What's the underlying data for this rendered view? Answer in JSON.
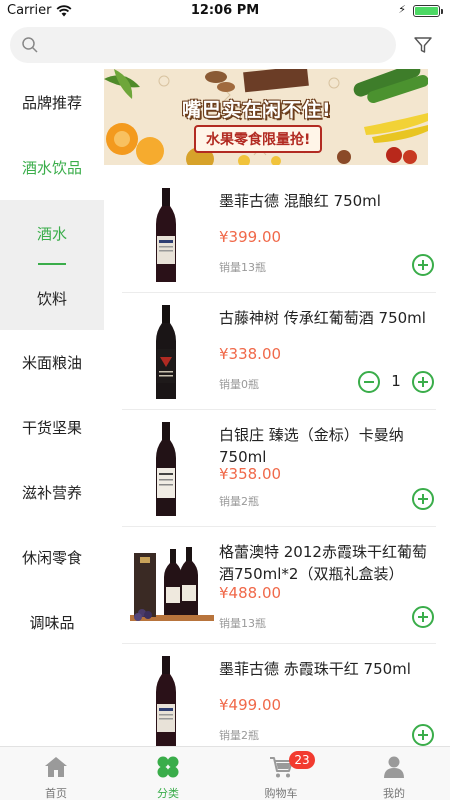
{
  "status_bar": {
    "carrier": "Carrier",
    "time": "12:06 PM"
  },
  "search": {
    "value": "",
    "placeholder": ""
  },
  "sidebar": {
    "categories": [
      {
        "label": "品牌推荐"
      },
      {
        "label": "酒水饮品",
        "active": true
      },
      {
        "label": "米面粮油"
      },
      {
        "label": "干货坚果"
      },
      {
        "label": "滋补营养"
      },
      {
        "label": "休闲零食"
      },
      {
        "label": "调味品"
      }
    ],
    "subcategories": [
      {
        "label": "酒水",
        "active": true
      },
      {
        "label": "饮料"
      }
    ]
  },
  "banner": {
    "title": "嘴巴实在闲不住!",
    "subtitle": "水果零食限量抢!"
  },
  "products": [
    {
      "name": "墨菲古德 混酿红 750ml",
      "price": "¥399.00",
      "sales": "销量13瓶"
    },
    {
      "name": "古藤神树 传承红葡萄酒 750ml",
      "price": "¥338.00",
      "sales": "销量0瓶",
      "quantity": "1"
    },
    {
      "name": "白银庄 臻选（金标）卡曼纳 750ml",
      "price": "¥358.00",
      "sales": "销量2瓶"
    },
    {
      "name": "格蕾澳特 2012赤霞珠干红葡萄酒750ml*2（双瓶礼盒装）",
      "price": "¥488.00",
      "sales": "销量13瓶"
    },
    {
      "name": "墨菲古德 赤霞珠干红 750ml",
      "price": "¥499.00",
      "sales": "销量2瓶"
    }
  ],
  "tabbar": {
    "tabs": [
      {
        "label": "首页",
        "icon": "home-icon"
      },
      {
        "label": "分类",
        "icon": "category-icon",
        "active": true
      },
      {
        "label": "购物车",
        "icon": "cart-icon",
        "badge": "23"
      },
      {
        "label": "我的",
        "icon": "profile-icon"
      }
    ]
  },
  "colors": {
    "accent": "#3aad4a",
    "price": "#f0694a",
    "badge": "#f23b30"
  }
}
